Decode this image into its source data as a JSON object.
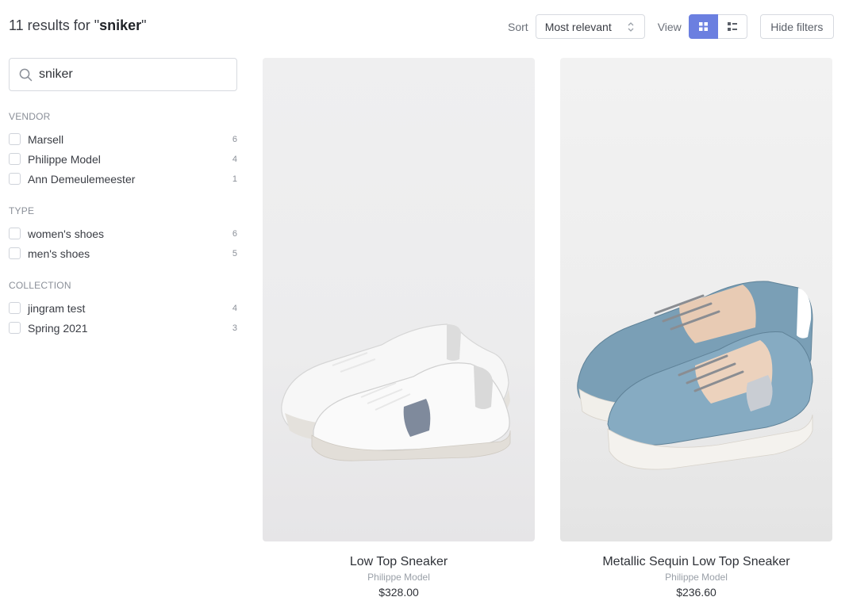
{
  "header": {
    "results_prefix": "11 results for \"",
    "query": "sniker",
    "results_suffix": "\""
  },
  "toolbar": {
    "sort_label": "Sort",
    "sort_value": "Most relevant",
    "view_label": "View",
    "view_mode": "grid",
    "hide_filters_label": "Hide filters"
  },
  "search": {
    "value": "sniker",
    "icon": "search-icon"
  },
  "filters": {
    "vendor": {
      "title": "VENDOR",
      "items": [
        {
          "label": "Marsell",
          "count": "6"
        },
        {
          "label": "Philippe Model",
          "count": "4"
        },
        {
          "label": "Ann Demeulemeester",
          "count": "1"
        }
      ]
    },
    "type": {
      "title": "TYPE",
      "items": [
        {
          "label": "women's shoes",
          "count": "6"
        },
        {
          "label": "men's shoes",
          "count": "5"
        }
      ]
    },
    "collection": {
      "title": "COLLECTION",
      "items": [
        {
          "label": "jingram test",
          "count": "4"
        },
        {
          "label": "Spring 2021",
          "count": "3"
        }
      ]
    }
  },
  "products": [
    {
      "title": "Low Top Sneaker",
      "vendor": "Philippe Model",
      "price": "$328.00"
    },
    {
      "title": "Metallic Sequin Low Top Sneaker",
      "vendor": "Philippe Model",
      "price": "$236.60"
    }
  ],
  "colors": {
    "accent": "#6b7fe0",
    "border": "#d7dae0"
  }
}
